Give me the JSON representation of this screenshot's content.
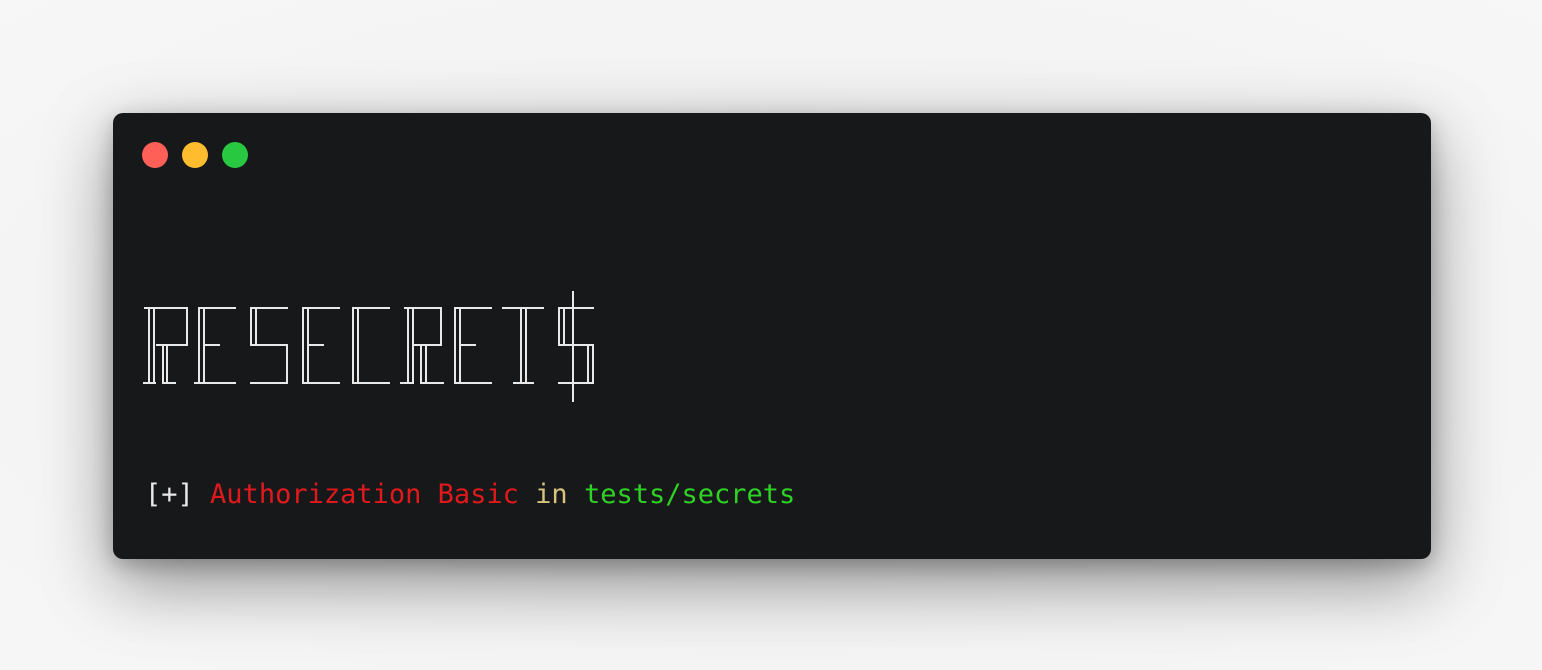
{
  "window": {
    "background": "#17181a",
    "traffic_lights": [
      {
        "name": "close",
        "color": "#fe5f57"
      },
      {
        "name": "minimize",
        "color": "#febc2e"
      },
      {
        "name": "zoom",
        "color": "#28c840"
      }
    ]
  },
  "banner": {
    "text": "RESECRET$",
    "style": "ascii-art line font",
    "color": "#e9e9e9"
  },
  "output": {
    "prefix": "[+]",
    "secret_type": "Authorization Basic",
    "connector": "in",
    "path": "tests/secrets",
    "colors": {
      "prefix": "#e9e9e9",
      "secret_type": "#e2191c",
      "connector": "#d6c37c",
      "path": "#2ed224"
    }
  }
}
